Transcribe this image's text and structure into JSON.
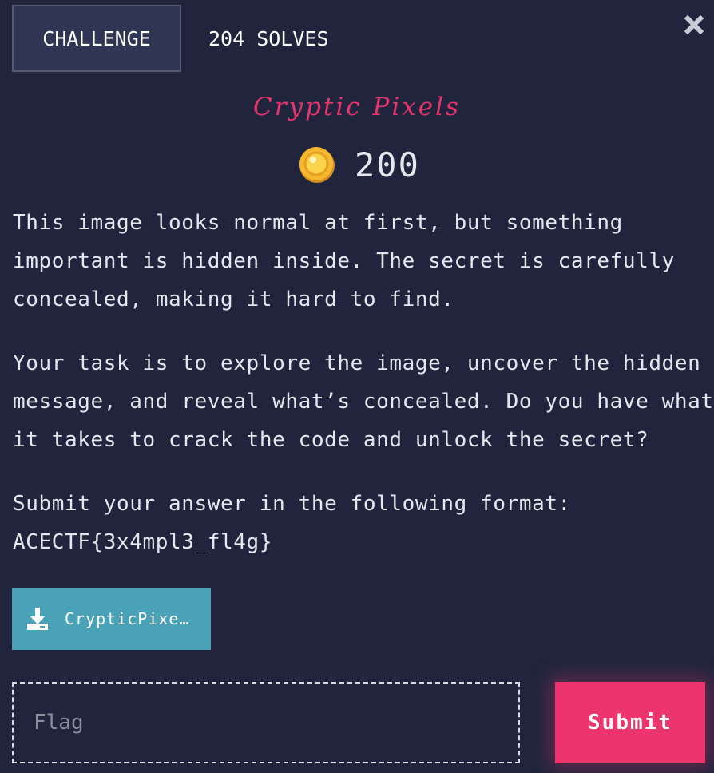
{
  "tabs": [
    {
      "label": "CHALLENGE",
      "active": true
    },
    {
      "label": "204 SOLVES",
      "active": false
    }
  ],
  "close_icon": "close-x-icon",
  "challenge": {
    "title": "Cryptic Pixels",
    "points": "200",
    "points_icon": "coin-icon"
  },
  "description": {
    "p1": [
      "This image looks normal at first, but something",
      "important is hidden inside. The secret is carefully",
      "concealed, making it hard to find."
    ],
    "p2": [
      "Your task is to explore the image, uncover the hidden",
      "message, and reveal what’s concealed. Do you have what",
      "it takes to crack the code and unlock the secret?"
    ],
    "p3": [
      "Submit your answer in the following format:",
      "ACECTF{3x4mpl3_fl4g}"
    ]
  },
  "download": {
    "label": "CrypticPixe…",
    "icon": "download-icon"
  },
  "flag_form": {
    "placeholder": "Flag",
    "value": "",
    "submit_label": "Submit"
  },
  "colors": {
    "background": "#20253d",
    "accent": "#ec346e",
    "download": "#4aa2b9",
    "tab_active": "#2f3654"
  }
}
